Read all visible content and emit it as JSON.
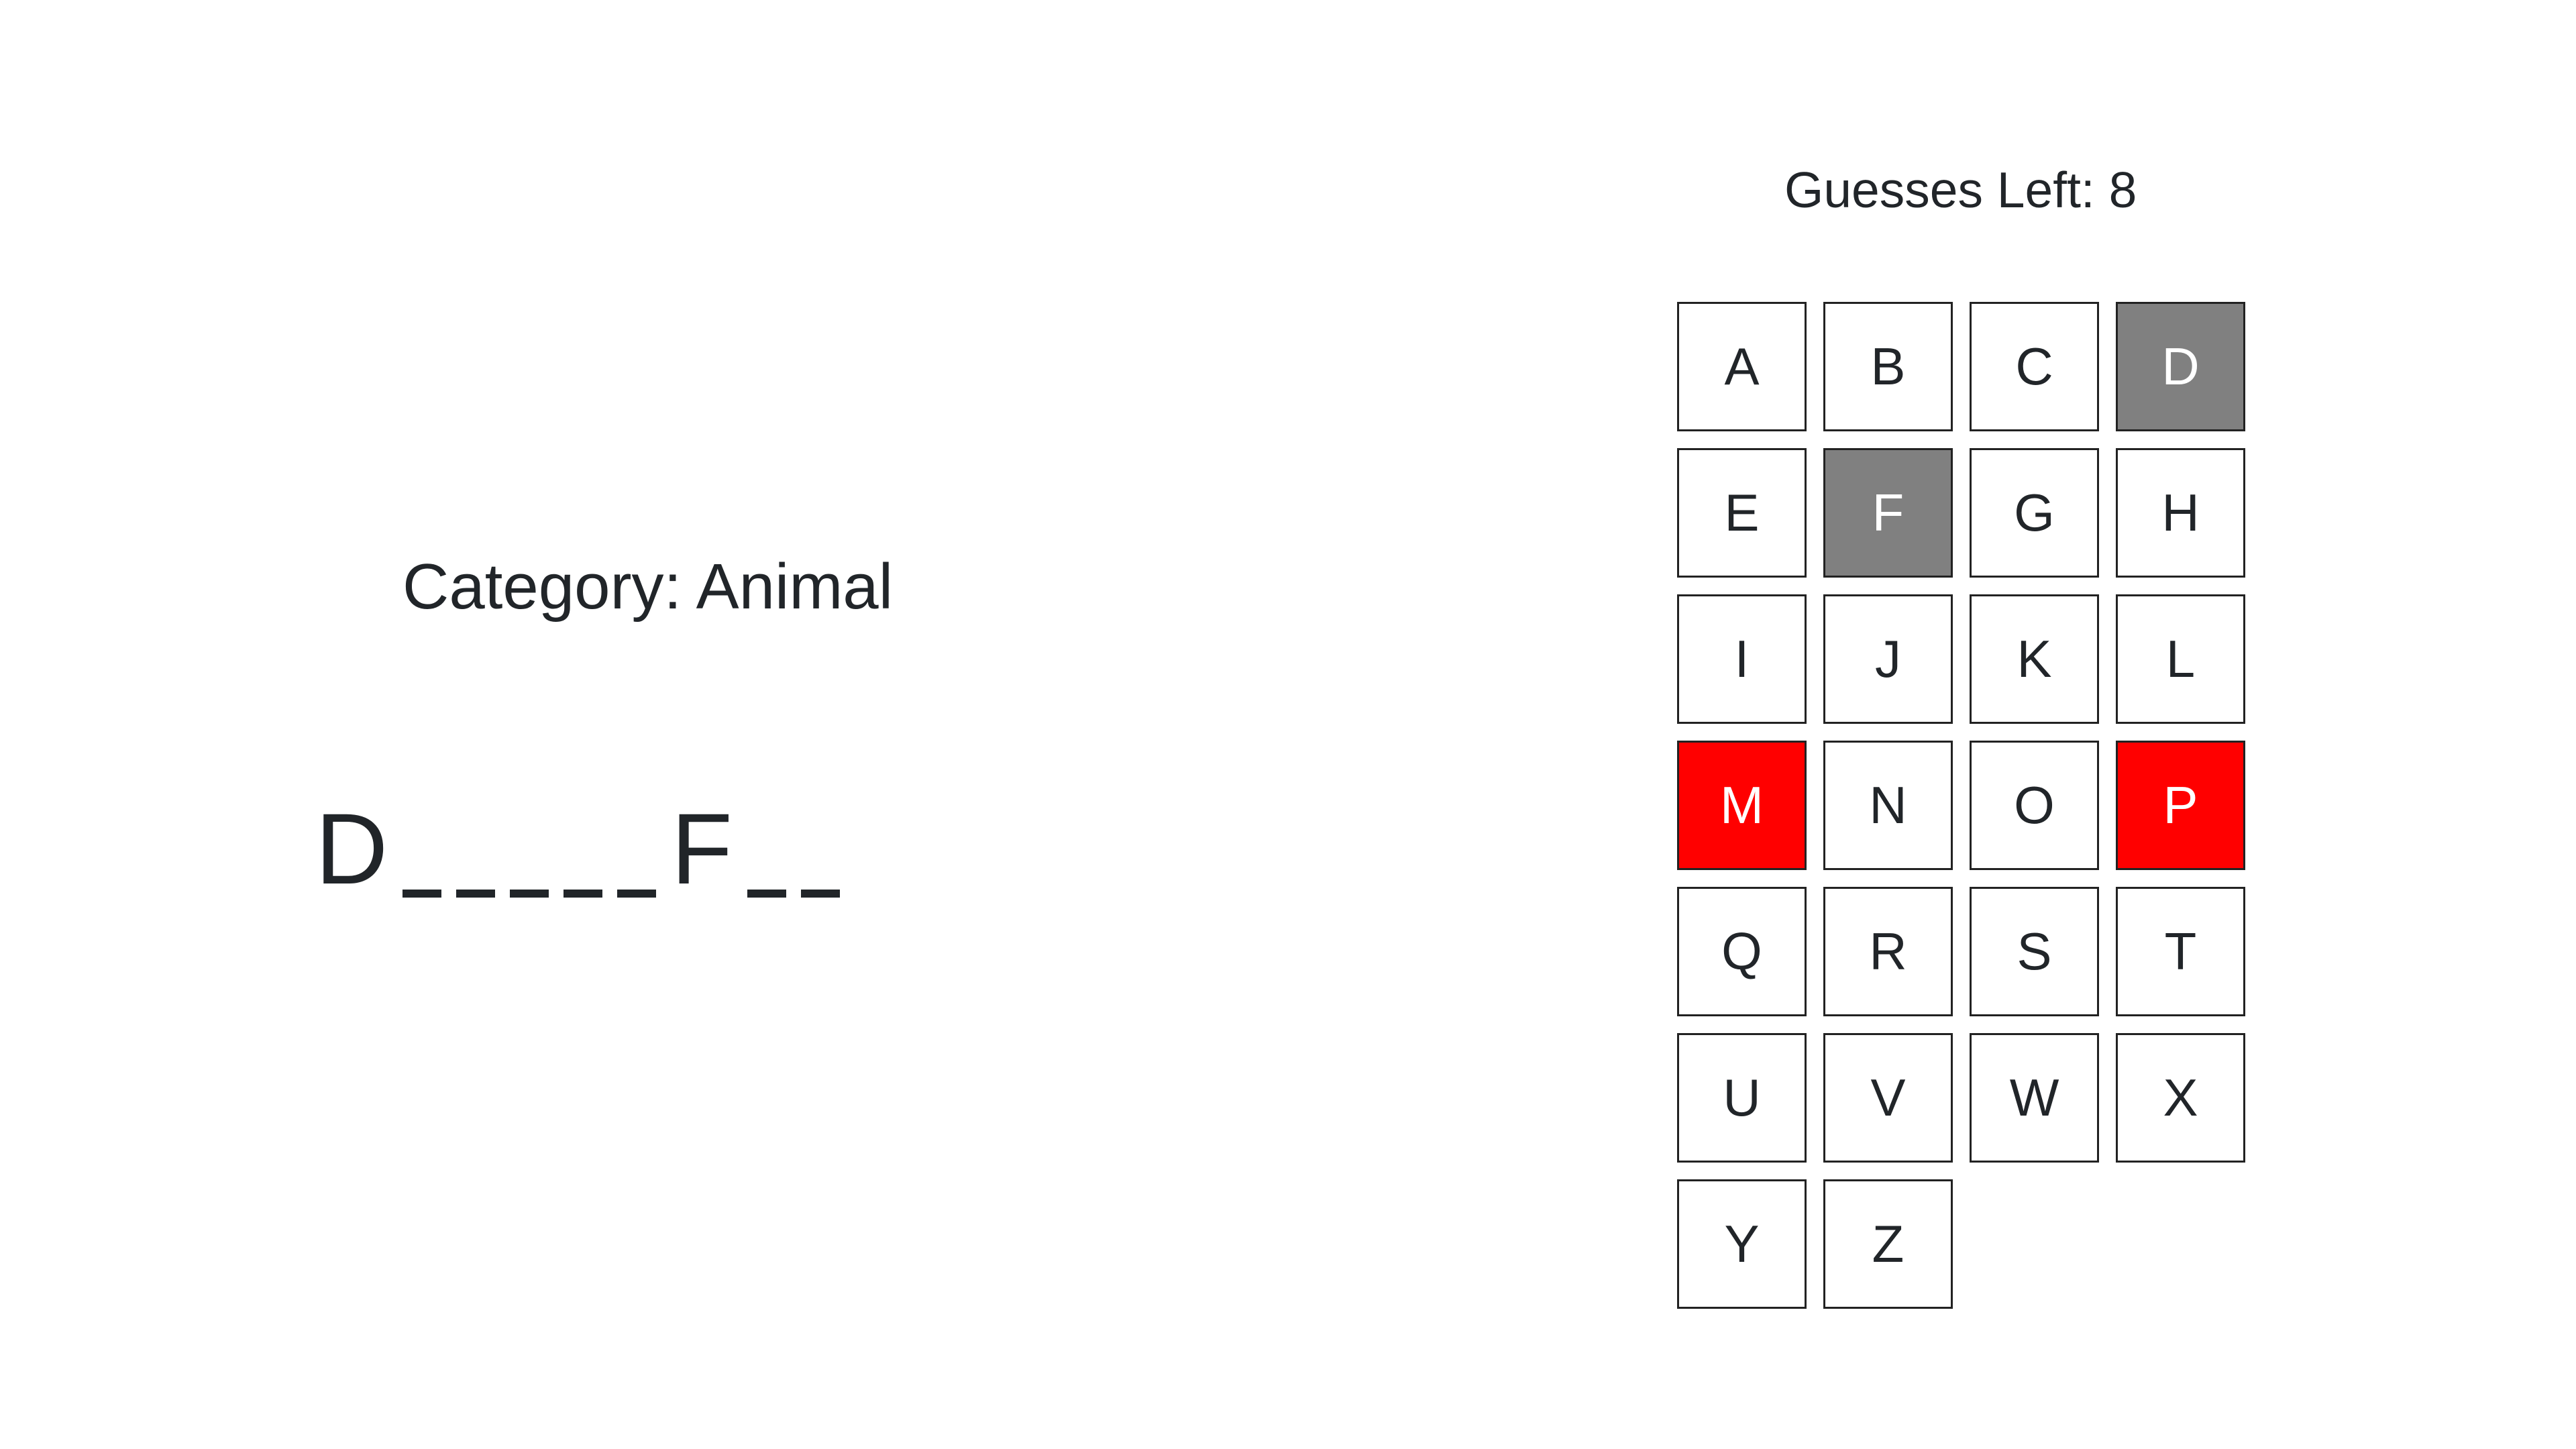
{
  "game": {
    "category_label": "Category: Animal",
    "guesses_left_label": "Guesses Left: 8",
    "word_slots": [
      {
        "char": "D",
        "revealed": true
      },
      {
        "char": "",
        "revealed": false
      },
      {
        "char": "",
        "revealed": false
      },
      {
        "char": "",
        "revealed": false
      },
      {
        "char": "",
        "revealed": false
      },
      {
        "char": "",
        "revealed": false
      },
      {
        "char": "F",
        "revealed": true
      },
      {
        "char": "",
        "revealed": false
      },
      {
        "char": "",
        "revealed": false
      }
    ]
  },
  "keyboard": {
    "keys": [
      {
        "letter": "A",
        "state": "unused"
      },
      {
        "letter": "B",
        "state": "unused"
      },
      {
        "letter": "C",
        "state": "unused"
      },
      {
        "letter": "D",
        "state": "correct"
      },
      {
        "letter": "E",
        "state": "unused"
      },
      {
        "letter": "F",
        "state": "correct"
      },
      {
        "letter": "G",
        "state": "unused"
      },
      {
        "letter": "H",
        "state": "unused"
      },
      {
        "letter": "I",
        "state": "unused"
      },
      {
        "letter": "J",
        "state": "unused"
      },
      {
        "letter": "K",
        "state": "unused"
      },
      {
        "letter": "L",
        "state": "unused"
      },
      {
        "letter": "M",
        "state": "wrong"
      },
      {
        "letter": "N",
        "state": "unused"
      },
      {
        "letter": "O",
        "state": "unused"
      },
      {
        "letter": "P",
        "state": "wrong"
      },
      {
        "letter": "Q",
        "state": "unused"
      },
      {
        "letter": "R",
        "state": "unused"
      },
      {
        "letter": "S",
        "state": "unused"
      },
      {
        "letter": "T",
        "state": "unused"
      },
      {
        "letter": "U",
        "state": "unused"
      },
      {
        "letter": "V",
        "state": "unused"
      },
      {
        "letter": "W",
        "state": "unused"
      },
      {
        "letter": "X",
        "state": "unused"
      },
      {
        "letter": "Y",
        "state": "unused"
      },
      {
        "letter": "Z",
        "state": "unused"
      }
    ]
  },
  "colors": {
    "correct_key": "#808080",
    "wrong_key": "#ff0000",
    "text": "#212529",
    "key_border": "#222222",
    "background": "#ffffff"
  }
}
